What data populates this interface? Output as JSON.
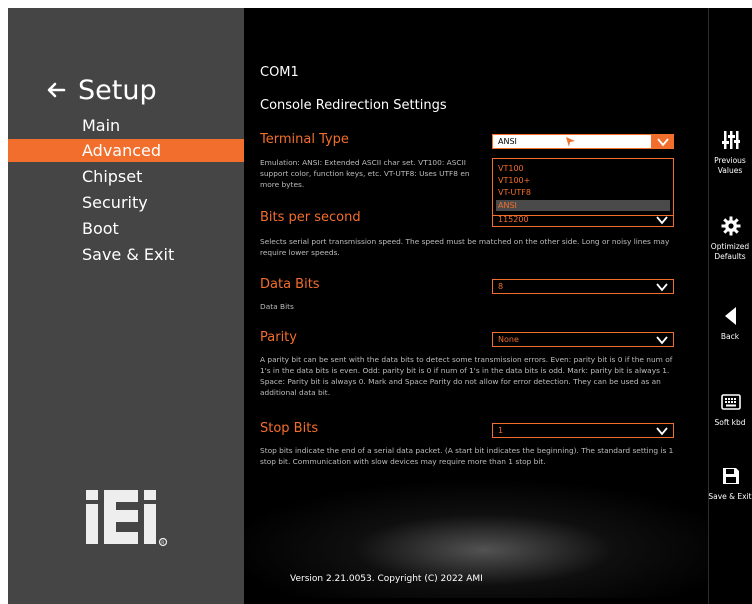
{
  "nav": {
    "title": "Setup",
    "items": [
      {
        "label": "Main",
        "active": false
      },
      {
        "label": "Advanced",
        "active": true
      },
      {
        "label": "Chipset",
        "active": false
      },
      {
        "label": "Security",
        "active": false
      },
      {
        "label": "Boot",
        "active": false
      },
      {
        "label": "Save & Exit",
        "active": false
      }
    ],
    "logo": "iEi"
  },
  "main": {
    "page_title": "COM1",
    "section_title": "Console Redirection Settings",
    "settings": {
      "terminal_type": {
        "label": "Terminal Type",
        "value": "ANSI",
        "help": "Emulation: ANSI: Extended ASCII char set. VT100: ASCII",
        "help2": "support color, function keys, etc. VT-UTF8: Uses UTF8 en",
        "help3": "more bytes.",
        "options": [
          "VT100",
          "VT100+",
          "VT-UTF8",
          "ANSI"
        ],
        "selected_option": "ANSI"
      },
      "bits_per_second": {
        "label": "Bits per second",
        "value": "115200",
        "help": "Selects serial port transmission speed. The speed must be matched on the other side. Long or noisy lines may require lower speeds."
      },
      "data_bits": {
        "label": "Data Bits",
        "value": "8",
        "help": "Data Bits"
      },
      "parity": {
        "label": "Parity",
        "value": "None",
        "help": "A parity bit can be sent with the data bits to detect some transmission errors. Even: parity bit is 0 if the num of 1's in the data bits is even. Odd: parity bit is 0 if num of 1's in the data bits is odd. Mark: parity bit is always 1. Space: Parity bit is always 0. Mark and Space Parity do not allow for error detection. They can be used as an additional data bit."
      },
      "stop_bits": {
        "label": "Stop Bits",
        "value": "1",
        "help": "Stop bits indicate the end of a serial data packet. (A start bit indicates the beginning). The standard setting is 1 stop bit. Communication with slow devices may require more than 1 stop bit."
      }
    },
    "version": "Version 2.21.0053. Copyright (C) 2022 AMI"
  },
  "toolbar": {
    "previous_values": "Previous Values",
    "optimized_defaults": "Optimized Defaults",
    "back": "Back",
    "soft_kbd": "Soft kbd",
    "save_exit": "Save & Exit"
  },
  "colors": {
    "accent": "#f26e2c",
    "nav_bg": "#454545",
    "main_bg": "#000000"
  }
}
